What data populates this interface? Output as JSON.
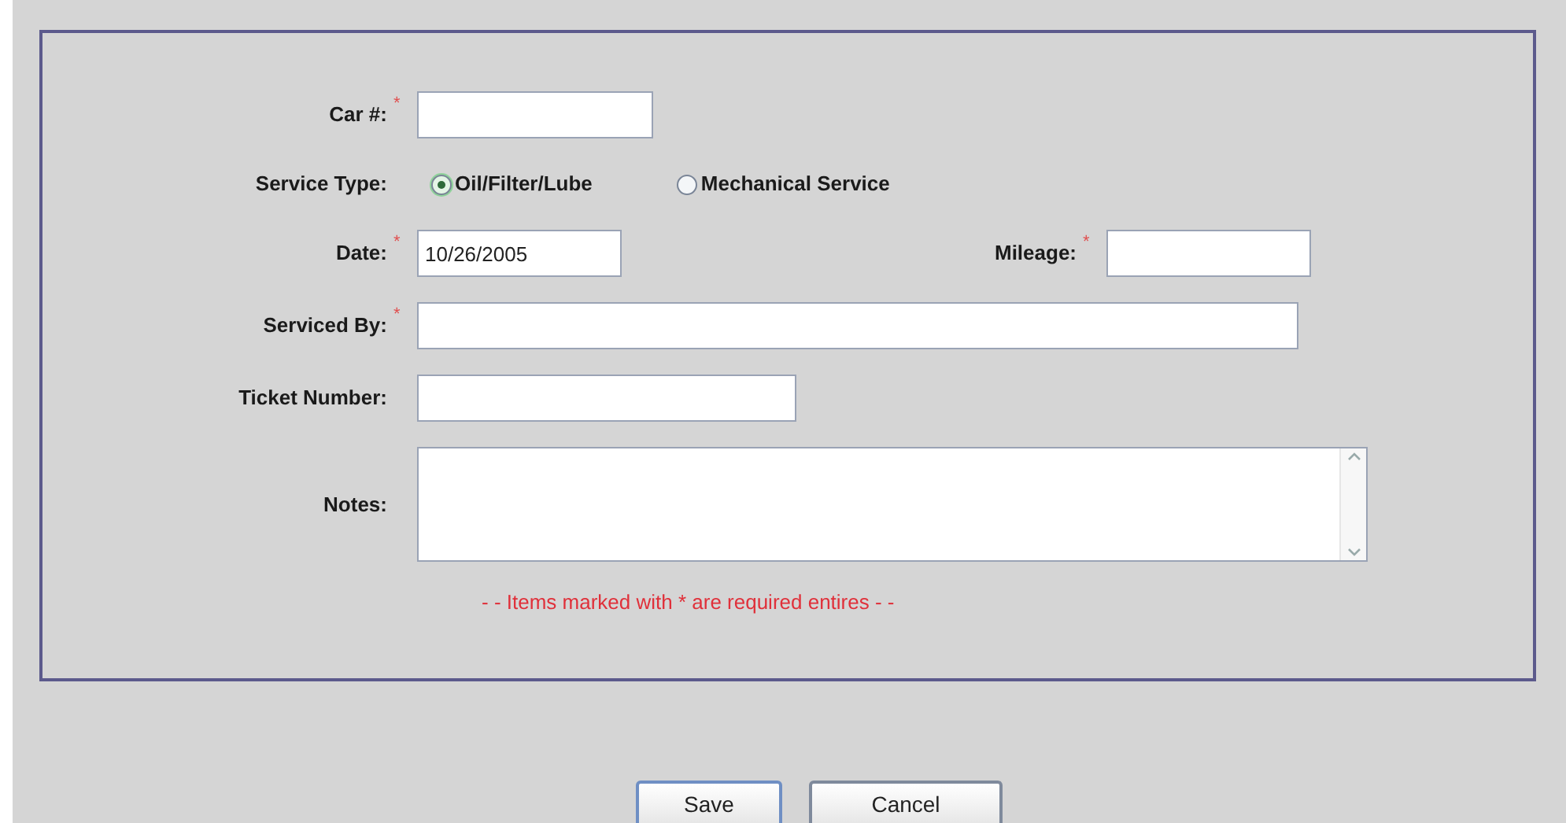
{
  "form": {
    "rows": [
      {
        "kind": "text",
        "label": "Car #:",
        "required_mark": "*"
      },
      {
        "kind": "radio",
        "label": "Service Type:",
        "options": [
          {
            "label": "Oil/Filter/Lube",
            "selected": true
          },
          {
            "label": "Mechanical Service",
            "selected": false
          }
        ]
      },
      {
        "kind": "text",
        "label": "Date:",
        "required_mark": "*",
        "value": "10/26/2005",
        "side": {
          "label": "Mileage:",
          "required_mark": "*"
        }
      },
      {
        "kind": "text",
        "label": "Serviced By:",
        "required_mark": "*"
      },
      {
        "kind": "text",
        "label": "Ticket Number:"
      },
      {
        "kind": "textarea",
        "label": "Notes:"
      }
    ],
    "required_note": "- - Items marked with * are required entires - -"
  },
  "buttons": [
    {
      "label": "Save",
      "default": true
    },
    {
      "label": "Cancel",
      "default": false
    }
  ]
}
